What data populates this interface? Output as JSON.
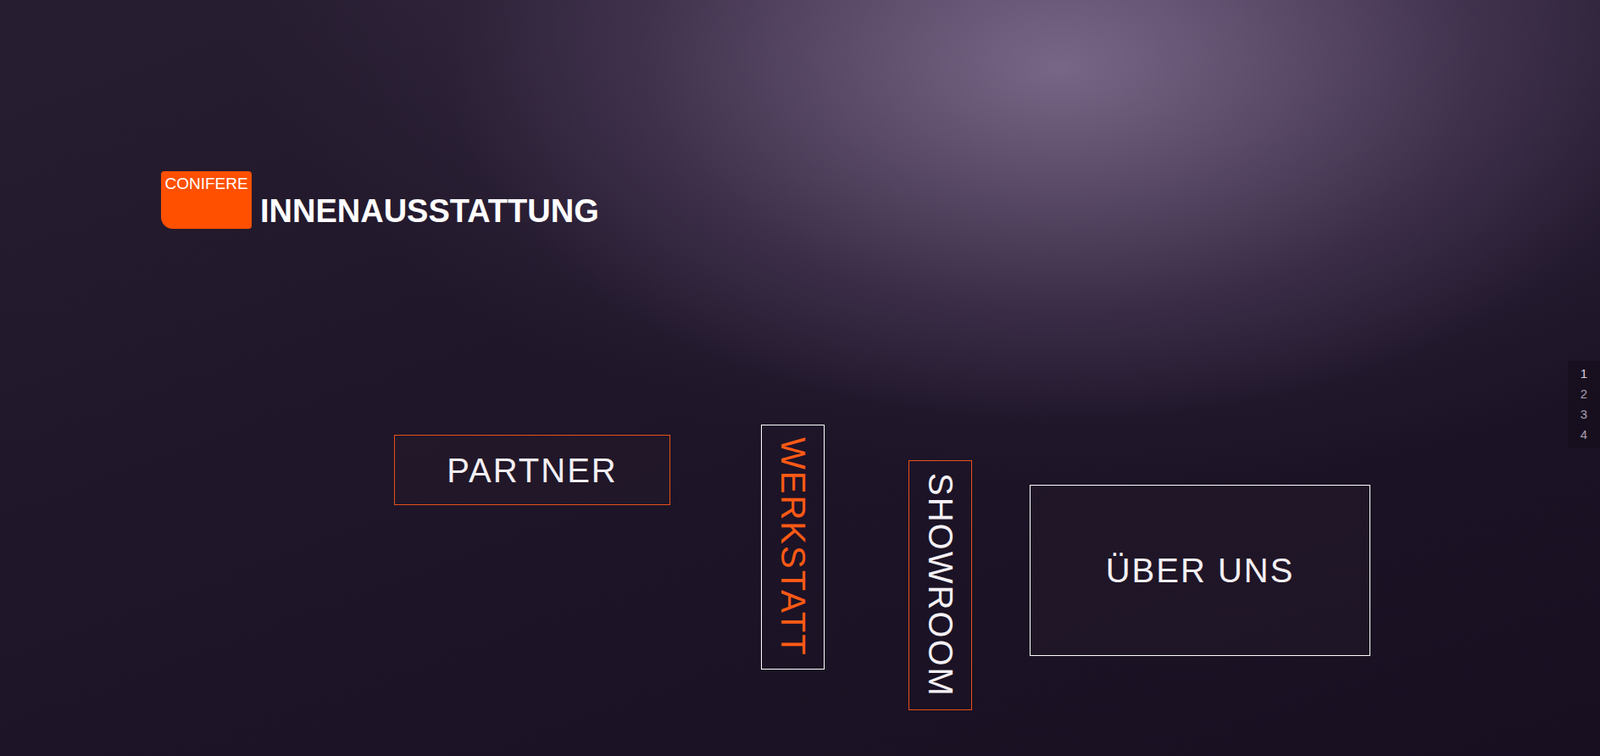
{
  "brand": {
    "badge": "CONIFERE",
    "title": "INNENAUSSTATTUNG"
  },
  "nav": [
    {
      "label": "PARTNER",
      "kind": "horizontal",
      "selected": false,
      "color": "#e8501a"
    },
    {
      "label": "WERKSTATT",
      "kind": "vertical",
      "selected": true,
      "color": "#ffffff"
    },
    {
      "label": "SHOWROOM",
      "kind": "vertical",
      "selected": false,
      "color": "#e8501a"
    },
    {
      "label": "ÜBER UNS",
      "kind": "horizontal",
      "selected": false,
      "color": "#ffffff"
    }
  ],
  "pager": [
    {
      "label": "1",
      "selected": true
    },
    {
      "label": "2",
      "selected": false
    },
    {
      "label": "3",
      "selected": false
    },
    {
      "label": "4",
      "selected": false
    }
  ]
}
